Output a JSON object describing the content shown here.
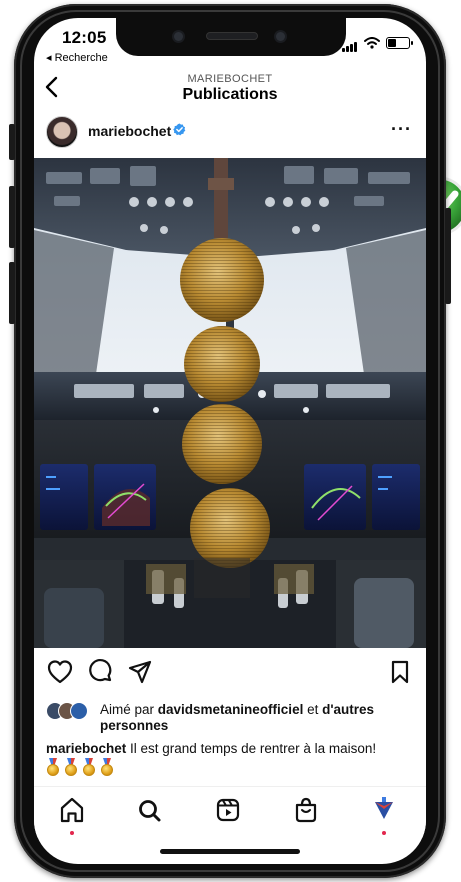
{
  "status_bar": {
    "time": "12:05",
    "back_app": "◂ Recherche"
  },
  "header": {
    "username_caps": "MARIEBOCHET",
    "title": "Publications"
  },
  "post": {
    "author": "mariebochet",
    "more": "···",
    "liked_prefix": "Aimé par ",
    "liked_user": "davidsmetanineofficiel",
    "liked_mid": " et ",
    "liked_others": "d'autres personnes",
    "caption_user": "mariebochet",
    "caption_text": " Il est grand temps de rentrer à la maison!",
    "medal_count": 4
  },
  "tab_bar": {
    "items": [
      "home-icon",
      "search-icon",
      "reels-icon",
      "shop-icon",
      "profile-icon"
    ],
    "active_dots": [
      "home-icon",
      "profile-icon"
    ]
  },
  "colors": {
    "accent_like_dot": "#e2264d",
    "verified_blue": "#3797f0",
    "checkmark_green": "#3aa63a"
  }
}
